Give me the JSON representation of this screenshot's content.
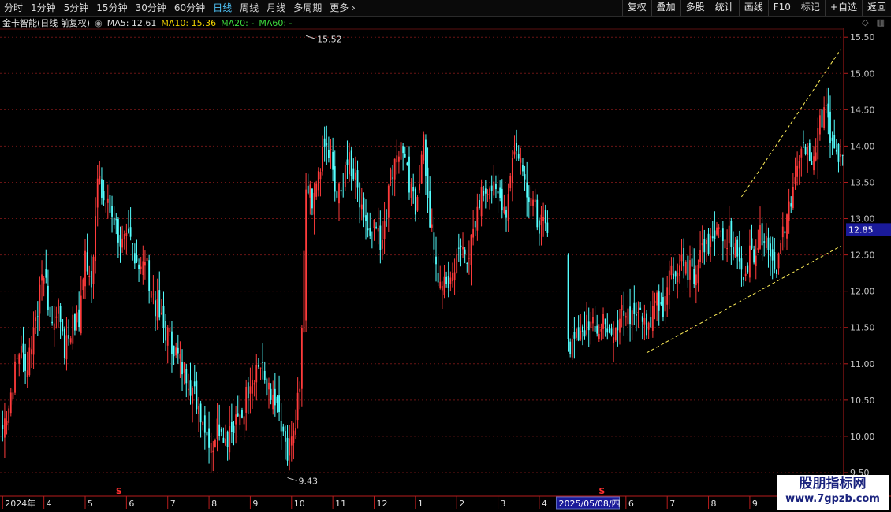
{
  "toolbar": {
    "periods": [
      "分时",
      "1分钟",
      "5分钟",
      "15分钟",
      "30分钟",
      "60分钟",
      "日线",
      "周线",
      "月线",
      "多周期",
      "更多"
    ],
    "active_period": "日线",
    "more_icon": "chevron-right-icon",
    "tools": [
      "复权",
      "叠加",
      "多股",
      "统计",
      "画线",
      "F10",
      "标记",
      "+自选",
      "返回"
    ]
  },
  "info": {
    "stock_name": "金卡智能(日线 前复权)",
    "ma_control_icon": "circle-dot-icon",
    "ma5": "MA5: 12.61",
    "ma10": "MA10: 15.36",
    "ma20": "MA20: -",
    "ma60": "MA60: -",
    "right_icons": [
      "diamond-icon",
      "panel-toggle-icon"
    ],
    "colors": {
      "ma5": "#e0e0e0",
      "ma10": "#f0d000",
      "ma20": "#3ddc3d",
      "ma60": "#3ddc3d"
    }
  },
  "chart_data": {
    "type": "candlestick",
    "ylim": [
      9.5,
      15.6
    ],
    "y_ticks": [
      "15.50",
      "15.00",
      "14.50",
      "14.00",
      "13.50",
      "13.00",
      "12.50",
      "12.00",
      "11.50",
      "11.00",
      "10.50",
      "10.00",
      "9.50"
    ],
    "y_tick_values": [
      15.5,
      15.0,
      14.5,
      14.0,
      13.5,
      13.0,
      12.5,
      12.0,
      11.5,
      11.0,
      10.5,
      10.0,
      9.5
    ],
    "current_price": "12.85",
    "current_price_value": 12.85,
    "x_labels": [
      "2024年",
      "4",
      "5",
      "6",
      "7",
      "8",
      "9",
      "10",
      "11",
      "12",
      "1",
      "2",
      "3",
      "4",
      "5",
      "6",
      "7",
      "8",
      "9"
    ],
    "x_label_index": [
      0,
      20,
      40,
      60,
      80,
      100,
      120,
      140,
      160,
      180,
      200,
      220,
      240,
      260,
      282,
      302,
      322,
      342,
      362
    ],
    "cursor_date": "2025/05/08/四",
    "cursor_index": 282,
    "dividend_marks": [
      {
        "index": 56,
        "label": "S"
      },
      {
        "index": 290,
        "label": "S"
      }
    ],
    "annotations": [
      {
        "label": "15.52",
        "index": 147,
        "value": 15.52
      },
      {
        "label": "9.43",
        "index": 138,
        "value": 9.43
      }
    ],
    "channel_lines": [
      {
        "from": [
          312,
          11.15
        ],
        "to": [
          406,
          12.62
        ]
      },
      {
        "from": [
          358,
          13.3
        ],
        "to": [
          406,
          15.33
        ]
      }
    ],
    "gap_range": [
      265,
      273
    ],
    "count": 408,
    "waypoints": [
      [
        0,
        10.1
      ],
      [
        4,
        10.6
      ],
      [
        8,
        11.2
      ],
      [
        12,
        11.0
      ],
      [
        17,
        11.8
      ],
      [
        20,
        12.2
      ],
      [
        24,
        11.5
      ],
      [
        27,
        11.9
      ],
      [
        30,
        11.2
      ],
      [
        33,
        11.5
      ],
      [
        37,
        11.6
      ],
      [
        40,
        12.5
      ],
      [
        43,
        12.2
      ],
      [
        46,
        13.5
      ],
      [
        50,
        13.2
      ],
      [
        54,
        13.0
      ],
      [
        58,
        12.6
      ],
      [
        62,
        12.7
      ],
      [
        66,
        12.4
      ],
      [
        70,
        12.3
      ],
      [
        74,
        11.8
      ],
      [
        78,
        11.5
      ],
      [
        82,
        11.3
      ],
      [
        86,
        11.0
      ],
      [
        90,
        10.8
      ],
      [
        94,
        10.5
      ],
      [
        98,
        10.2
      ],
      [
        101,
        9.8
      ],
      [
        104,
        10.2
      ],
      [
        108,
        10.0
      ],
      [
        112,
        10.1
      ],
      [
        116,
        10.3
      ],
      [
        120,
        10.8
      ],
      [
        124,
        11.0
      ],
      [
        127,
        10.8
      ],
      [
        130,
        10.5
      ],
      [
        133,
        10.3
      ],
      [
        136,
        10.0
      ],
      [
        138,
        9.65
      ],
      [
        141,
        10.1
      ],
      [
        144,
        10.6
      ],
      [
        147,
        13.4
      ],
      [
        150,
        13.3
      ],
      [
        153,
        13.6
      ],
      [
        156,
        14.1
      ],
      [
        159,
        13.8
      ],
      [
        162,
        13.4
      ],
      [
        165,
        13.5
      ],
      [
        168,
        13.8
      ],
      [
        171,
        13.5
      ],
      [
        174,
        13.2
      ],
      [
        177,
        12.9
      ],
      [
        180,
        13.0
      ],
      [
        183,
        12.6
      ],
      [
        186,
        13.2
      ],
      [
        190,
        13.9
      ],
      [
        194,
        14.0
      ],
      [
        197,
        13.4
      ],
      [
        200,
        13.2
      ],
      [
        204,
        14.0
      ],
      [
        207,
        13.0
      ],
      [
        210,
        12.3
      ],
      [
        213,
        12.0
      ],
      [
        216,
        12.1
      ],
      [
        219,
        12.3
      ],
      [
        222,
        12.6
      ],
      [
        226,
        12.5
      ],
      [
        229,
        12.9
      ],
      [
        232,
        13.3
      ],
      [
        235,
        13.5
      ],
      [
        238,
        13.4
      ],
      [
        241,
        13.3
      ],
      [
        244,
        13.1
      ],
      [
        247,
        13.8
      ],
      [
        250,
        14.0
      ],
      [
        253,
        13.5
      ],
      [
        256,
        13.3
      ],
      [
        259,
        13.0
      ],
      [
        262,
        12.9
      ],
      [
        264,
        12.8
      ],
      [
        274,
        11.2
      ],
      [
        277,
        11.5
      ],
      [
        280,
        11.3
      ],
      [
        283,
        11.6
      ],
      [
        286,
        11.7
      ],
      [
        289,
        11.4
      ],
      [
        292,
        11.6
      ],
      [
        296,
        11.5
      ],
      [
        300,
        11.7
      ],
      [
        304,
        11.6
      ],
      [
        308,
        11.8
      ],
      [
        311,
        11.5
      ],
      [
        314,
        11.6
      ],
      [
        317,
        11.9
      ],
      [
        320,
        11.8
      ],
      [
        323,
        12.3
      ],
      [
        326,
        12.2
      ],
      [
        329,
        12.4
      ],
      [
        332,
        12.3
      ],
      [
        335,
        12.2
      ],
      [
        338,
        12.5
      ],
      [
        341,
        12.6
      ],
      [
        344,
        12.7
      ],
      [
        347,
        12.9
      ],
      [
        350,
        12.8
      ],
      [
        353,
        12.7
      ],
      [
        356,
        12.4
      ],
      [
        359,
        12.3
      ],
      [
        362,
        12.5
      ],
      [
        365,
        12.6
      ],
      [
        368,
        12.8
      ],
      [
        371,
        12.7
      ],
      [
        374,
        12.3
      ],
      [
        377,
        12.6
      ],
      [
        380,
        13.0
      ],
      [
        383,
        13.5
      ],
      [
        386,
        13.7
      ],
      [
        389,
        14.0
      ],
      [
        392,
        13.8
      ],
      [
        395,
        14.1
      ],
      [
        398,
        14.6
      ],
      [
        400,
        14.3
      ],
      [
        402,
        14.0
      ],
      [
        404,
        13.9
      ],
      [
        406,
        13.8
      ],
      [
        407,
        13.75
      ]
    ]
  }
}
